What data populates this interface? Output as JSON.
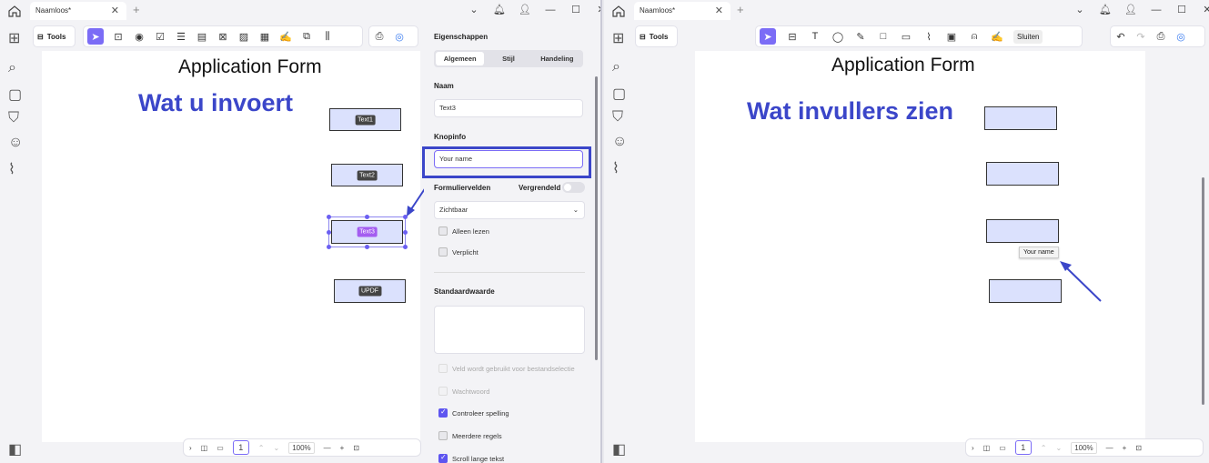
{
  "left": {
    "tab_title": "Naamloos*",
    "tools_label": "Tools",
    "doc_title": "Application Form",
    "annotation": "Wat u invoert",
    "fields": [
      {
        "label": "Text1"
      },
      {
        "label": "Text2"
      },
      {
        "label": "Text3"
      },
      {
        "label": "UPDF"
      }
    ],
    "properties": {
      "heading": "Eigenschappen",
      "tabs": [
        "Algemeen",
        "Stijl",
        "Handeling"
      ],
      "name_label": "Naam",
      "name_value": "Text3",
      "tooltip_label": "Knopinfo",
      "tooltip_value": "Your name",
      "form_fields_label": "Formuliervelden",
      "locked_label": "Vergrendeld",
      "visibility_value": "Zichtbaar",
      "readonly_label": "Alleen lezen",
      "required_label": "Verplicht",
      "default_label": "Standaardwaarde",
      "file_select_label": "Veld wordt gebruikt voor bestandselectie",
      "password_label": "Wachtwoord",
      "spellcheck_label": "Controleer spelling",
      "multiline_label": "Meerdere regels",
      "scroll_label": "Scroll lange tekst"
    },
    "page_number": "1",
    "zoom": "100%"
  },
  "right": {
    "tab_title": "Naamloos*",
    "tools_label": "Tools",
    "exit_label": "Sluiten",
    "doc_title": "Application Form",
    "annotation": "Wat invullers zien",
    "tooltip": "Your name",
    "page_number": "1",
    "zoom": "100%"
  },
  "colors": {
    "accent": "#7b6cf6",
    "annotation": "#3b46c9",
    "field_fill": "#dbe1fd"
  }
}
